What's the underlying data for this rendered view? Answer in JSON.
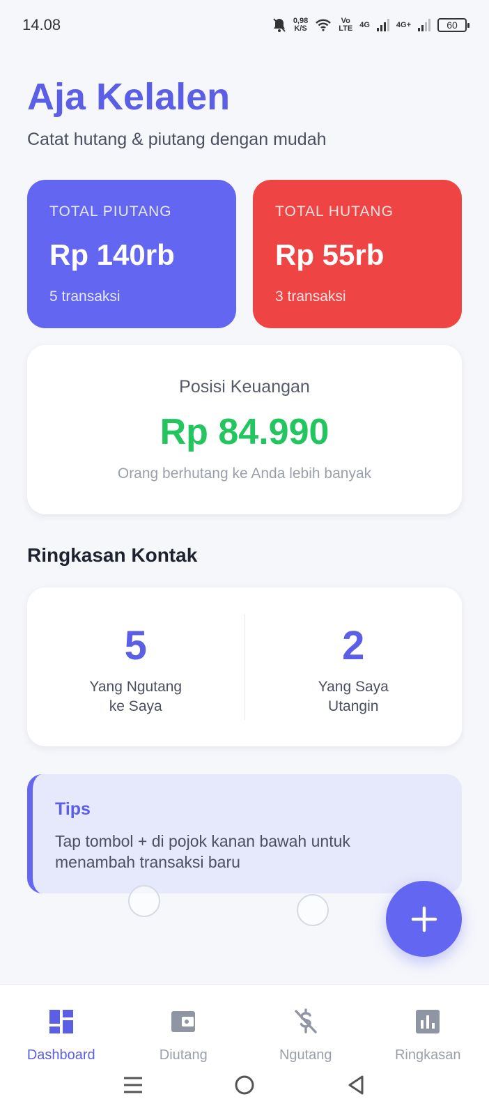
{
  "status_bar": {
    "time": "14.08",
    "net_speed_value": "0,98",
    "net_speed_unit": "K/S",
    "volte_top": "Vo",
    "volte_bottom": "LTE",
    "net1": "4G",
    "net2": "4G+",
    "battery": "60"
  },
  "header": {
    "title": "Aja Kelalen",
    "subtitle": "Catat hutang & piutang dengan mudah"
  },
  "summary": {
    "piutang": {
      "label": "TOTAL PIUTANG",
      "amount": "Rp 140rb",
      "count": "5 transaksi",
      "color": "#6366f1"
    },
    "hutang": {
      "label": "TOTAL HUTANG",
      "amount": "Rp 55rb",
      "count": "3 transaksi",
      "color": "#ef4444"
    }
  },
  "position": {
    "title": "Posisi Keuangan",
    "amount": "Rp 84.990",
    "note": "Orang berhutang ke Anda lebih banyak",
    "amount_color": "#22c55e"
  },
  "contacts": {
    "title": "Ringkasan Kontak",
    "owe_me": {
      "count": "5",
      "label": "Yang Ngutang\nke Saya"
    },
    "i_owe": {
      "count": "2",
      "label": "Yang Saya\nUtangin"
    }
  },
  "tips": {
    "title": "Tips",
    "body": "Tap tombol + di pojok kanan bawah untuk menambah transaksi baru"
  },
  "fab": {
    "icon": "plus-icon"
  },
  "nav": {
    "items": [
      {
        "label": "Dashboard",
        "icon": "dashboard-icon",
        "active": true
      },
      {
        "label": "Diutang",
        "icon": "wallet-icon",
        "active": false
      },
      {
        "label": "Ngutang",
        "icon": "dollar-off-icon",
        "active": false
      },
      {
        "label": "Ringkasan",
        "icon": "bar-chart-icon",
        "active": false
      }
    ]
  },
  "accent_color": "#5b5fe6"
}
